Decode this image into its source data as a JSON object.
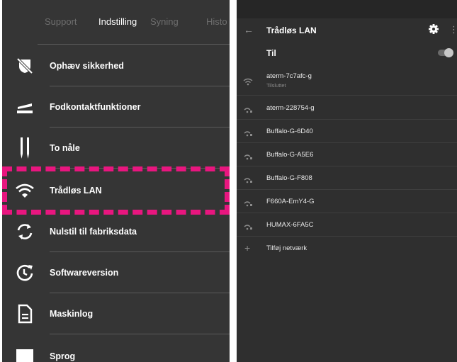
{
  "left_panel": {
    "tabs": [
      {
        "label": "Support",
        "active": false
      },
      {
        "label": "Indstilling",
        "active": true
      },
      {
        "label": "Syning",
        "active": false
      },
      {
        "label": "Histo",
        "active": false
      }
    ],
    "menu": [
      {
        "label": "Ophæv sikkerhed",
        "icon": "unlock-off-icon"
      },
      {
        "label": "Fodkontaktfunktioner",
        "icon": "foot-pedal-icon"
      },
      {
        "label": "To nåle",
        "icon": "twin-needle-icon"
      },
      {
        "label": "Trådløs LAN",
        "icon": "wifi-icon"
      },
      {
        "label": "Nulstil til fabriksdata",
        "icon": "reset-icon"
      },
      {
        "label": "Softwareversion",
        "icon": "update-icon"
      },
      {
        "label": "Maskinlog",
        "icon": "document-icon"
      },
      {
        "label": "Sprog",
        "icon": "language-icon"
      }
    ],
    "highlight_color": "#e8167f"
  },
  "right_panel": {
    "title": "Trådløs LAN",
    "back_glyph": "←",
    "more_glyph": "⋮",
    "toggle": {
      "label": "Til",
      "on": true
    },
    "networks": [
      {
        "name": "aterm-7c7afc-g",
        "status": "Tilsluttet"
      },
      {
        "name": "aterm-228754-g",
        "status": ""
      },
      {
        "name": "Buffalo-G-6D40",
        "status": ""
      },
      {
        "name": "Buffalo-G-A5E6",
        "status": ""
      },
      {
        "name": "Buffalo-G-F808",
        "status": ""
      },
      {
        "name": "F660A-EmY4-G",
        "status": ""
      },
      {
        "name": "HUMAX-6FA5C",
        "status": ""
      }
    ],
    "add_network": {
      "glyph": "+",
      "label": "Tilføj netværk"
    }
  }
}
